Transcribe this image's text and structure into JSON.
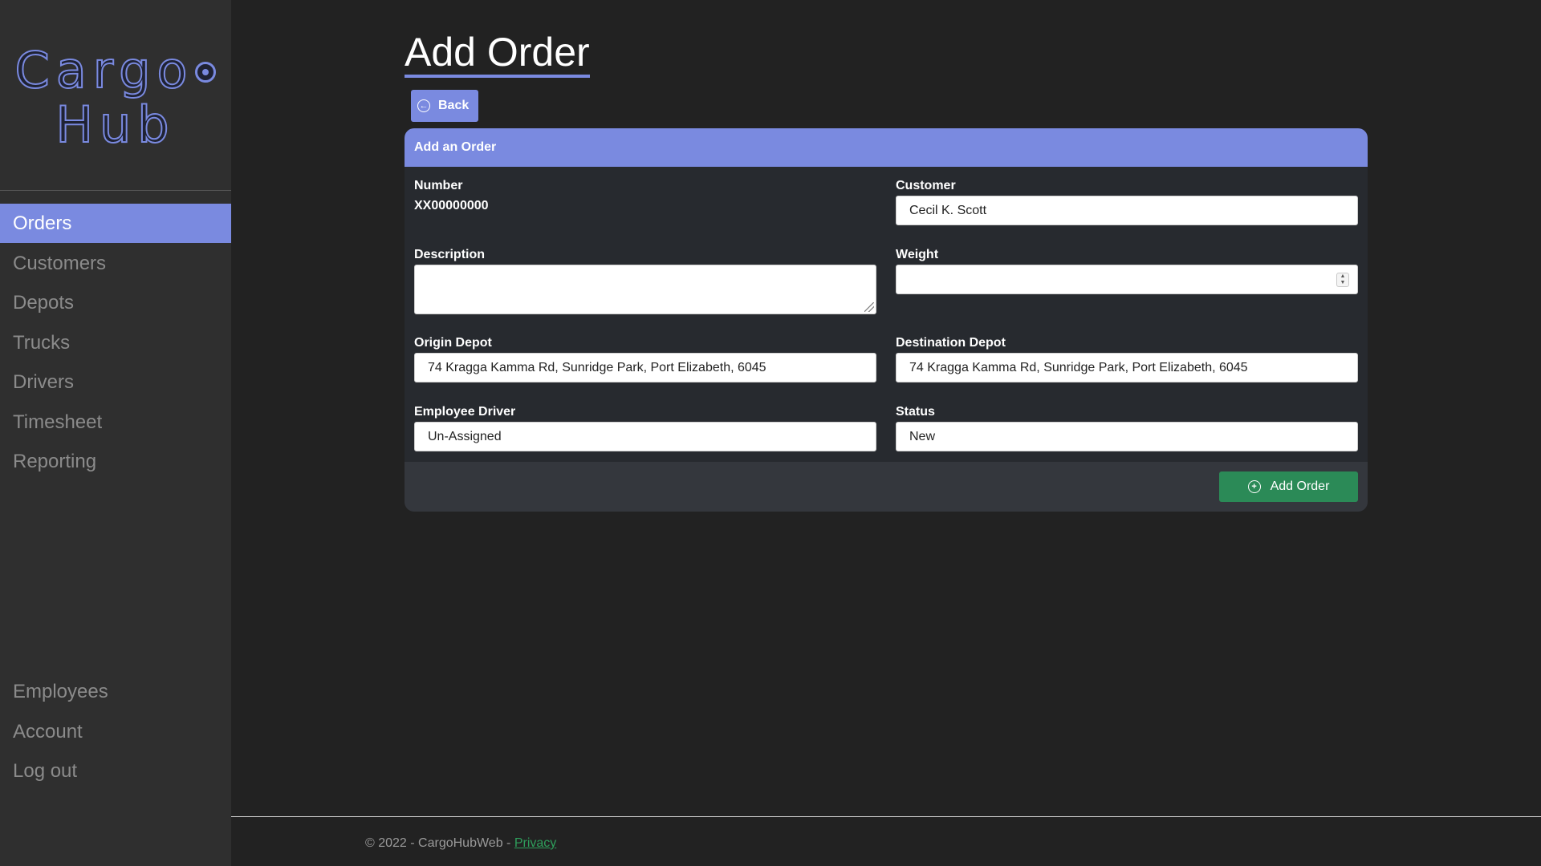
{
  "app": {
    "logo_line1": "Cargo",
    "logo_line2": "Hub"
  },
  "sidebar": {
    "items": [
      {
        "label": "Orders",
        "active": true
      },
      {
        "label": "Customers"
      },
      {
        "label": "Depots"
      },
      {
        "label": "Trucks"
      },
      {
        "label": "Drivers"
      },
      {
        "label": "Timesheet"
      },
      {
        "label": "Reporting"
      }
    ],
    "bottom_items": [
      {
        "label": "Employees"
      },
      {
        "label": "Account"
      },
      {
        "label": "Log out"
      }
    ]
  },
  "page": {
    "title": "Add Order",
    "back_label": "Back"
  },
  "form": {
    "header": "Add an Order",
    "number_label": "Number",
    "number_value": "XX00000000",
    "customer_label": "Customer",
    "customer_value": "Cecil K. Scott",
    "description_label": "Description",
    "description_value": "",
    "weight_label": "Weight",
    "weight_value": "",
    "origin_label": "Origin Depot",
    "origin_value": "74 Kragga Kamma Rd, Sunridge Park, Port Elizabeth, 6045",
    "destination_label": "Destination Depot",
    "destination_value": "74 Kragga Kamma Rd, Sunridge Park, Port Elizabeth, 6045",
    "driver_label": "Employee Driver",
    "driver_value": "Un-Assigned",
    "status_label": "Status",
    "status_value": "New",
    "submit_label": "Add Order"
  },
  "footer": {
    "copyright": "© 2022 - CargoHubWeb - ",
    "privacy_label": "Privacy"
  },
  "colors": {
    "accent": "#7a8ae0",
    "success": "#2b8a57",
    "background": "#222222",
    "sidebar": "#2f2f2f"
  },
  "icons": {
    "back": "arrow-left-circle-icon",
    "add": "plus-circle-icon",
    "logo": "gear-icon"
  }
}
